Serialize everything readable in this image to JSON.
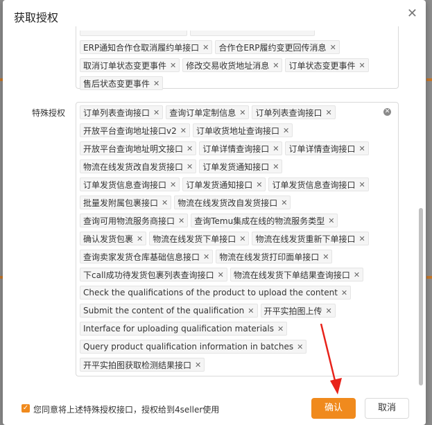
{
  "dialog": {
    "title": "获取授权",
    "close_icon": "close-icon"
  },
  "top_permissions": {
    "partial_tags": [
      "[partially hidden]",
      "[partially hidden]"
    ],
    "tags": [
      "ERP通知合作仓取消履约单接口",
      "合作仓ERP履约变更回传消息",
      "取消订单状态变更事件",
      "修改交易收货地址消息",
      "订单状态变更事件",
      "售后状态变更事件"
    ]
  },
  "special_permissions": {
    "label": "特殊授权",
    "tags": [
      "订单列表查询接口",
      "查询订单定制信息",
      "订单列表查询接口",
      "开放平台查询地址接口v2",
      "订单收货地址查询接口",
      "开放平台查询地址明文接口",
      "订单详情查询接口",
      "订单详情查询接口",
      "物流在线发货改自发货接口",
      "订单发货通知接口",
      "订单发货信息查询接口",
      "订单发货通知接口",
      "订单发货信息查询接口",
      "批量发附属包裹接口",
      "物流在线发货改自发货接口",
      "查询可用物流服务商接口",
      "查询Temu集成在线的物流服务类型",
      "确认发货包裹",
      "物流在线发货下单接口",
      "物流在线发货重新下单接口",
      "查询卖家发货仓库基础信息接口",
      "物流在线发货打印面单接口",
      "下call成功待发货包裹列表查询接口",
      "物流在线发货下单结果查询接口",
      "Check the qualifications of the product to upload the content",
      "Submit the content of the qualification",
      "开平实拍图上传",
      "Interface for uploading qualification materials",
      "Query product qualification information in batches",
      "开平实拍图获取检测结果接口"
    ]
  },
  "footer": {
    "agree_text": "您同意将上述特殊授权接口，授权给到4seller使用",
    "agree_checked": true,
    "confirm_label": "确认",
    "cancel_label": "取消"
  },
  "colors": {
    "accent": "#f08a1d",
    "annotation_arrow": "#e8221a"
  }
}
